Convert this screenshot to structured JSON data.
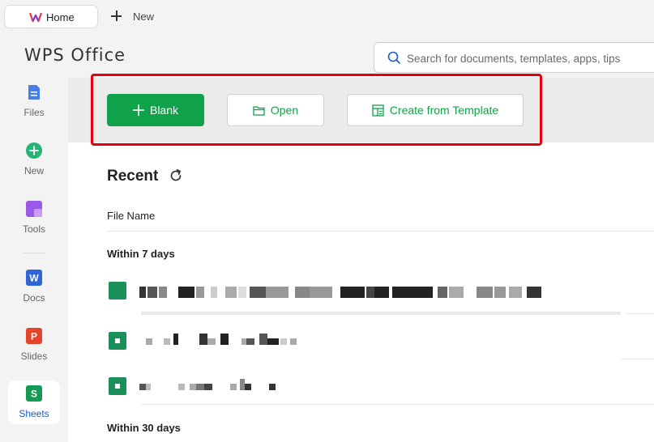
{
  "tabs": {
    "home": "Home",
    "new": "New"
  },
  "brand": "WPS Office",
  "search": {
    "placeholder": "Search for documents, templates, apps, tips"
  },
  "sidebar": {
    "items": [
      {
        "label": "Files"
      },
      {
        "label": "New"
      },
      {
        "label": "Tools"
      },
      {
        "label": "Docs"
      },
      {
        "label": "Slides"
      },
      {
        "label": "Sheets"
      }
    ]
  },
  "actions": {
    "blank": "Blank",
    "open": "Open",
    "template": "Create from Template"
  },
  "recent": {
    "title": "Recent",
    "column_file_name": "File Name",
    "group_7_days": "Within 7 days",
    "group_30_days": "Within 30 days"
  },
  "colors": {
    "accent_green": "#0fa24a",
    "highlight_red": "#e4000f",
    "active_blue": "#1a5bd1"
  },
  "icons": [
    "wps-logo-icon",
    "plus-icon",
    "search-icon",
    "files-icon",
    "new-plus-icon",
    "tools-icon",
    "docs-icon",
    "slides-icon",
    "sheets-icon",
    "folder-icon",
    "template-icon",
    "refresh-icon",
    "sheet-file-icon"
  ]
}
